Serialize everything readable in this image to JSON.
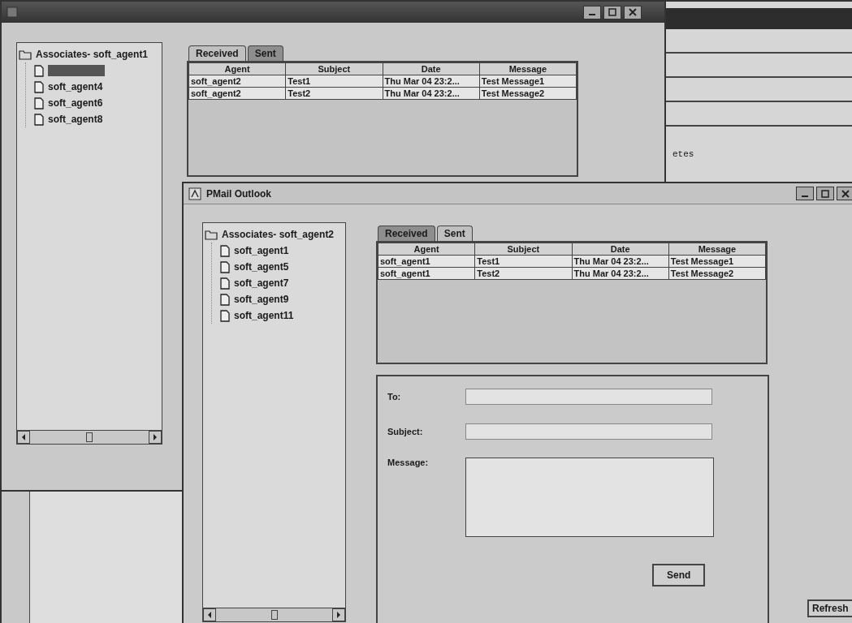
{
  "back_window": {
    "tree": {
      "root": "Associates- soft_agent1",
      "children": [
        {
          "selected": true
        },
        {
          "label": "soft_agent4",
          "selected": false
        },
        {
          "label": "soft_agent6",
          "selected": false
        },
        {
          "label": "soft_agent8",
          "selected": false
        }
      ]
    },
    "tabs": [
      {
        "label": "Received",
        "selected": false
      },
      {
        "label": "Sent",
        "selected": true
      }
    ],
    "table": {
      "columns": [
        "Agent",
        "Subject",
        "Date",
        "Message"
      ],
      "rows": [
        [
          "soft_agent2",
          "Test1",
          "Thu Mar 04 23:2...",
          "Test Message1"
        ],
        [
          "soft_agent2",
          "Test2",
          "Thu Mar 04 23:2...",
          "Test Message2"
        ]
      ]
    }
  },
  "side_window": {
    "text": "etes"
  },
  "front_window": {
    "title": "PMail Outlook",
    "tree": {
      "root": "Associates- soft_agent2",
      "children": [
        {
          "label": "soft_agent1",
          "selected": false
        },
        {
          "label": "soft_agent5",
          "selected": false
        },
        {
          "label": "soft_agent7",
          "selected": false
        },
        {
          "label": "soft_agent9",
          "selected": false
        },
        {
          "label": "soft_agent11",
          "selected": false
        }
      ]
    },
    "tabs": [
      {
        "label": "Received",
        "selected": true
      },
      {
        "label": "Sent",
        "selected": false
      }
    ],
    "table": {
      "columns": [
        "Agent",
        "Subject",
        "Date",
        "Message"
      ],
      "rows": [
        [
          "soft_agent1",
          "Test1",
          "Thu Mar 04 23:2...",
          "Test Message1"
        ],
        [
          "soft_agent1",
          "Test2",
          "Thu Mar 04 23:2...",
          "Test Message2"
        ]
      ]
    },
    "compose": {
      "fields": [
        {
          "label": "To:",
          "kind": "line"
        },
        {
          "label": "Subject:",
          "kind": "line"
        },
        {
          "label": "Message:",
          "kind": "area"
        }
      ],
      "send_button": "Send"
    },
    "refresh_button": "Refresh"
  }
}
